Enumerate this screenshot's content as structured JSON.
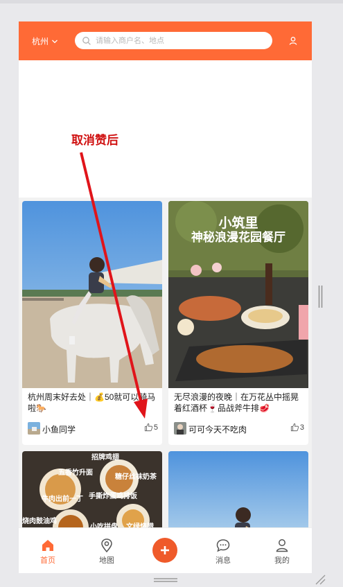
{
  "header": {
    "city": "杭州",
    "search_placeholder": "请输入商户名、地点"
  },
  "annotation": {
    "text": "取消赞后"
  },
  "cards": [
    {
      "image_text": "",
      "title": "杭州周末好去处｜💰50就可以骑马啦🐎",
      "author": "小鱼同学",
      "likes": "5"
    },
    {
      "image_text_line1": "小筑里",
      "image_text_line2": "神秘浪漫花园餐厅",
      "title": "无尽浪漫的夜晚｜在万花丛中摇晃着红酒杯🍷品战斧牛排🥩",
      "author": "可可今天不吃肉",
      "likes": "3"
    },
    {
      "image_labels": [
        "招牌鸡翅",
        "五香竹升面",
        "糖仔丝袜奶茶",
        "牛肉出前一丁",
        "手撕炸蛋鸡排饭",
        "烧肉鼓油鸡",
        "小吃拼盘",
        "文绿烧腊"
      ],
      "title": "",
      "author": "",
      "likes": ""
    },
    {
      "title": "",
      "author": "",
      "likes": ""
    }
  ],
  "tabbar": {
    "home": "首页",
    "map": "地图",
    "messages": "消息",
    "mine": "我的"
  },
  "colors": {
    "brand": "#ff6a36",
    "annotation": "#d01212"
  }
}
